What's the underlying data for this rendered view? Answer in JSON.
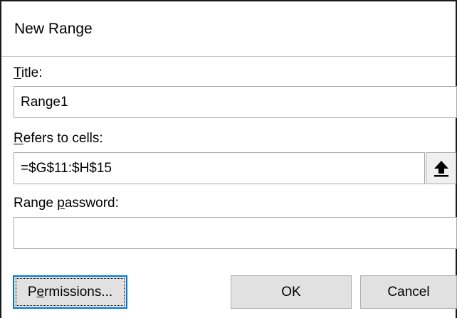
{
  "dialog": {
    "title": "New Range"
  },
  "fields": {
    "title": {
      "label_accel": "T",
      "label_rest": "itle:",
      "value": "Range1"
    },
    "refers_to": {
      "label_accel": "R",
      "label_rest": "efers to cells:",
      "value": "=$G$11:$H$15",
      "collapse_icon": "up-arrow-icon"
    },
    "password": {
      "label_pre": "Range ",
      "label_accel": "p",
      "label_rest": "assword:",
      "value": ""
    }
  },
  "buttons": {
    "permissions_pre": "P",
    "permissions_accel": "e",
    "permissions_rest": "rmissions...",
    "ok": "OK",
    "cancel": "Cancel"
  },
  "colors": {
    "focus_border": "#0078d7",
    "button_face": "#e1e1e1",
    "field_border": "#a9a9a9"
  }
}
